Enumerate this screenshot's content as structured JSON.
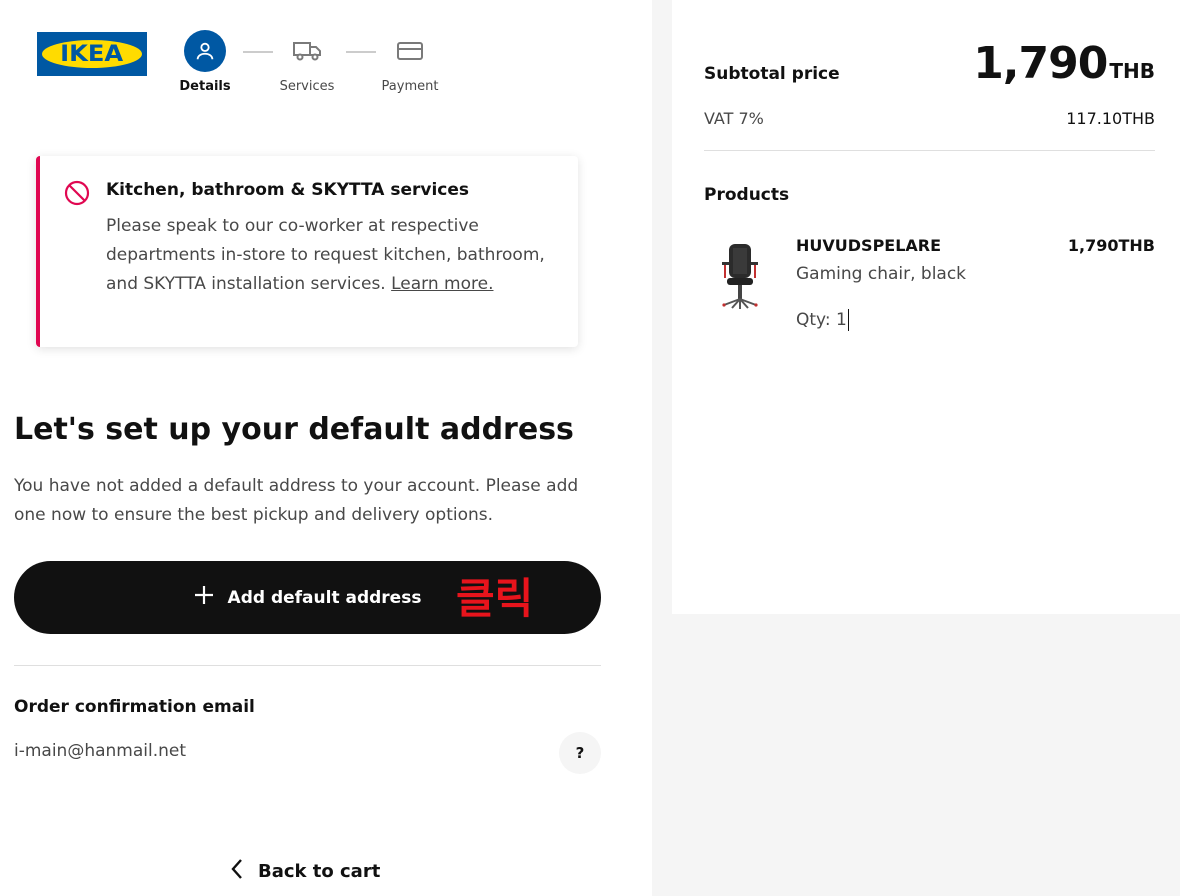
{
  "brand": {
    "logo_text": "IKEA",
    "blue": "#0058a3",
    "yellow": "#ffdb00"
  },
  "stepper": [
    {
      "label": "Details",
      "icon": "person-icon",
      "active": true
    },
    {
      "label": "Services",
      "icon": "truck-icon",
      "active": false
    },
    {
      "label": "Payment",
      "icon": "credit-card-icon",
      "active": false
    }
  ],
  "notice": {
    "icon": "ban-icon",
    "title": "Kitchen, bathroom & SKYTTA services",
    "body": "Please speak to our co-worker at respective departments in-store to request kitchen, bathroom, and SKYTTA installation services.",
    "link": "Learn more.",
    "accent": "#e00751"
  },
  "address": {
    "heading": "Let's set up your default address",
    "description": "You have not added a default address to your account. Please add one now to ensure the best pickup and delivery options.",
    "button_label": "Add default address",
    "annotation": "클릭"
  },
  "email": {
    "label": "Order confirmation email",
    "value": "i-main@hanmail.net",
    "help": "?"
  },
  "back": {
    "label": "Back to cart"
  },
  "summary": {
    "subtotal_label": "Subtotal price",
    "subtotal_value": "1,790",
    "subtotal_currency": "THB",
    "vat_label": "VAT 7%",
    "vat_value": "117.10THB",
    "products_label": "Products",
    "products": [
      {
        "name": "HUVUDSPELARE",
        "description": "Gaming chair, black",
        "price": "1,790THB",
        "qty_label": "Qty:",
        "qty": "1"
      }
    ]
  }
}
